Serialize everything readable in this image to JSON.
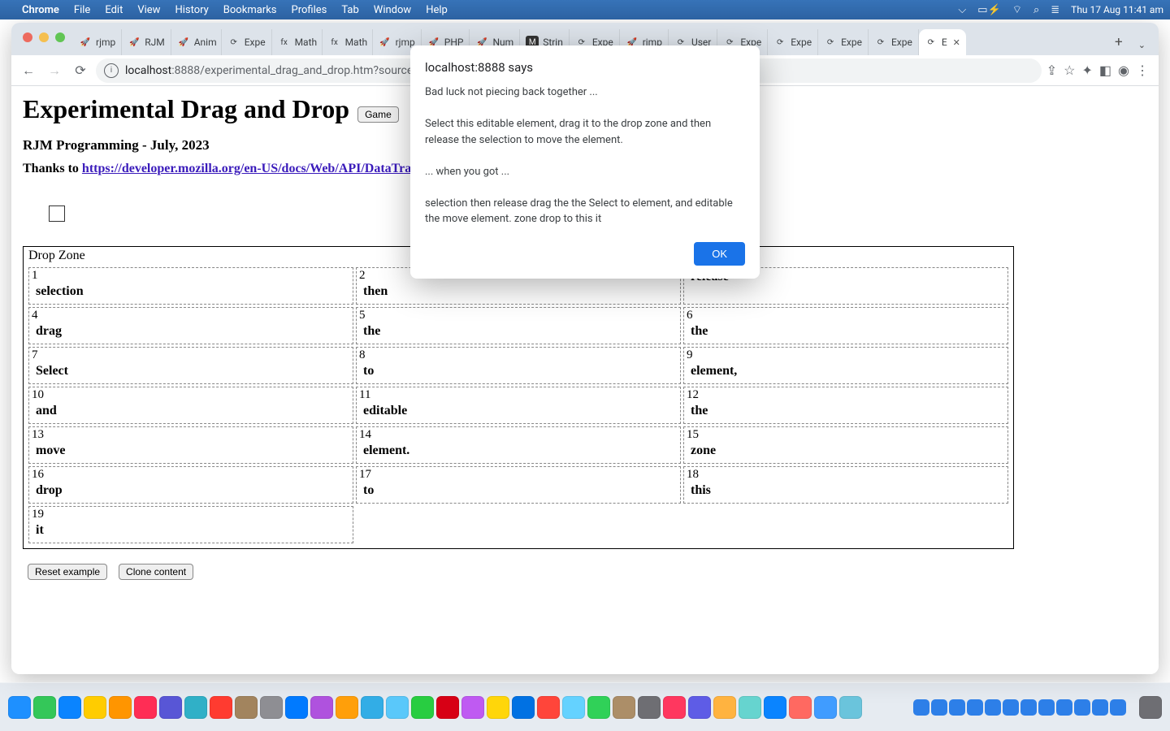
{
  "menubar": {
    "appname": "Chrome",
    "items": [
      "File",
      "Edit",
      "View",
      "History",
      "Bookmarks",
      "Profiles",
      "Tab",
      "Window",
      "Help"
    ],
    "clock": "Thu 17 Aug  11:41 am"
  },
  "tabs": [
    {
      "label": "rjmp",
      "fav": "🚀"
    },
    {
      "label": "RJM",
      "fav": "🚀"
    },
    {
      "label": "Anim",
      "fav": "🚀"
    },
    {
      "label": "Expe",
      "fav": "⟳"
    },
    {
      "label": "Math",
      "fav": "fx"
    },
    {
      "label": "Math",
      "fav": "fx"
    },
    {
      "label": "rjmp",
      "fav": "🚀"
    },
    {
      "label": "PHP",
      "fav": "🚀"
    },
    {
      "label": "Num",
      "fav": "🚀"
    },
    {
      "label": "Strin",
      "fav": "M"
    },
    {
      "label": "Expe",
      "fav": "⟳"
    },
    {
      "label": "rjmp",
      "fav": "🚀"
    },
    {
      "label": "User",
      "fav": "⟳"
    },
    {
      "label": "Expe",
      "fav": "⟳"
    },
    {
      "label": "Expe",
      "fav": "⟳"
    },
    {
      "label": "Expe",
      "fav": "⟳"
    },
    {
      "label": "Expe",
      "fav": "⟳"
    },
    {
      "label": "E",
      "fav": "⟳",
      "active": true
    }
  ],
  "url": {
    "host": "localhost",
    "port": ":8888",
    "path": "/experimental_drag_and_drop.htm?sourcenum=&shuffle="
  },
  "page": {
    "h1": "Experimental Drag and Drop",
    "game_btn": "Game",
    "h3": "RJM Programming - July, 2023",
    "thanks_prefix": "Thanks to ",
    "thanks_link": "https://developer.mozilla.org/en-US/docs/Web/API/DataTran",
    "dropzone_label": "Drop Zone",
    "reset_btn": "Reset example",
    "clone_btn": "Clone content"
  },
  "cells": [
    {
      "n": "1",
      "w": "selection"
    },
    {
      "n": "2",
      "w": "then"
    },
    {
      "n": "",
      "w": "release"
    },
    {
      "n": "4",
      "w": "drag"
    },
    {
      "n": "5",
      "w": "the"
    },
    {
      "n": "6",
      "w": "the"
    },
    {
      "n": "7",
      "w": "Select"
    },
    {
      "n": "8",
      "w": "to"
    },
    {
      "n": "9",
      "w": "element,"
    },
    {
      "n": "10",
      "w": "and"
    },
    {
      "n": "11",
      "w": "editable"
    },
    {
      "n": "12",
      "w": "the"
    },
    {
      "n": "13",
      "w": "move"
    },
    {
      "n": "14",
      "w": "element."
    },
    {
      "n": "15",
      "w": "zone"
    },
    {
      "n": "16",
      "w": "drop"
    },
    {
      "n": "17",
      "w": "to"
    },
    {
      "n": "18",
      "w": "this"
    },
    {
      "n": "19",
      "w": "it"
    }
  ],
  "alert": {
    "title": "localhost:8888 says",
    "body": "Bad luck not piecing back together ...\n\nSelect this editable element, drag it to the drop zone and then release the selection to move the element.\n\n   ... when you got ...\n\nselection then release drag the the Select to element, and editable the move element. zone drop to this it",
    "ok": "OK"
  },
  "dock_colors": [
    "#1e90ff",
    "#34c759",
    "#0a84ff",
    "#ffcc00",
    "#ff9500",
    "#ff2d55",
    "#5856d6",
    "#30b0c7",
    "#ff3b30",
    "#a2845e",
    "#8e8e93",
    "#007aff",
    "#af52de",
    "#ff9f0a",
    "#32ade6",
    "#5ac8fa",
    "#28cd41",
    "#d70015",
    "#bf5af2",
    "#ffd60a",
    "#0071e3",
    "#ff453a",
    "#64d2ff",
    "#30d158",
    "#ac8e68",
    "#6e6e73",
    "#ff375f",
    "#5e5ce6",
    "#ffb340",
    "#66d4cf",
    "#0a84ff",
    "#ff6961",
    "#409cff",
    "#6ac4dc"
  ]
}
